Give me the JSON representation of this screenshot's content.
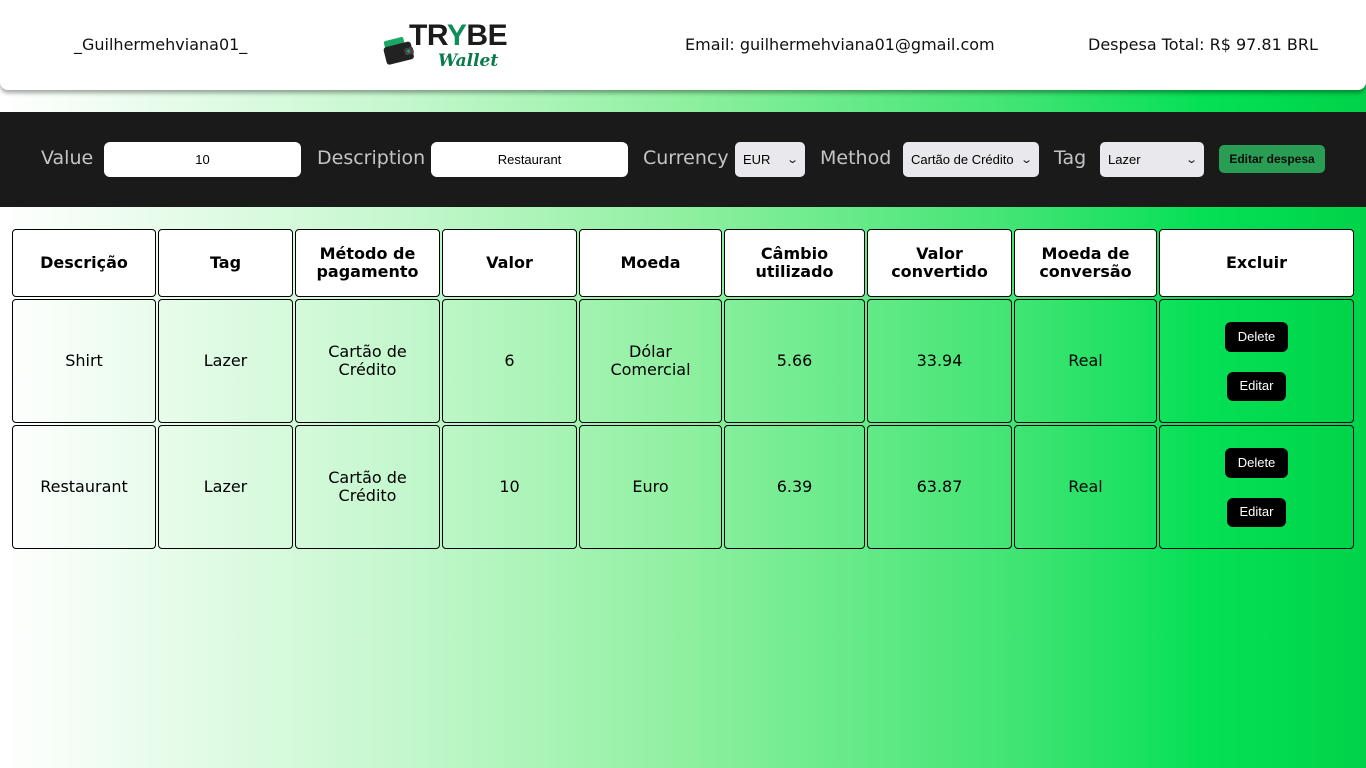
{
  "header": {
    "username": "_Guilhermehviana01_",
    "logo_main_before": "TR",
    "logo_main_y": "Y",
    "logo_main_after": "BE",
    "logo_sub": "Wallet",
    "email": "Email: guilhermehviana01@gmail.com",
    "total": "Despesa Total: R$ 97.81 BRL",
    "brand_color": "#0d8e5b"
  },
  "form": {
    "value_label": "Value",
    "value": "10",
    "description_label": "Description",
    "description": "Restaurant",
    "currency_label": "Currency",
    "currency": "EUR",
    "method_label": "Method",
    "method": "Cartão de Crédito",
    "tag_label": "Tag",
    "tag": "Lazer",
    "submit_label": "Editar despesa",
    "submit_color": "#2a9d55"
  },
  "table": {
    "headers": [
      "Descrição",
      "Tag",
      "Método de pagamento",
      "Valor",
      "Moeda",
      "Câmbio utilizado",
      "Valor convertido",
      "Moeda de conversão",
      "Excluir"
    ],
    "rows": [
      {
        "descricao": "Shirt",
        "tag": "Lazer",
        "metodo": "Cartão de Crédito",
        "valor": "6",
        "moeda": "Dólar Comercial",
        "cambio": "5.66",
        "convertido": "33.94",
        "moeda_conversao": "Real",
        "delete_label": "Delete",
        "edit_label": "Editar"
      },
      {
        "descricao": "Restaurant",
        "tag": "Lazer",
        "metodo": "Cartão de Crédito",
        "valor": "10",
        "moeda": "Euro",
        "cambio": "6.39",
        "convertido": "63.87",
        "moeda_conversao": "Real",
        "delete_label": "Delete",
        "edit_label": "Editar"
      }
    ]
  }
}
